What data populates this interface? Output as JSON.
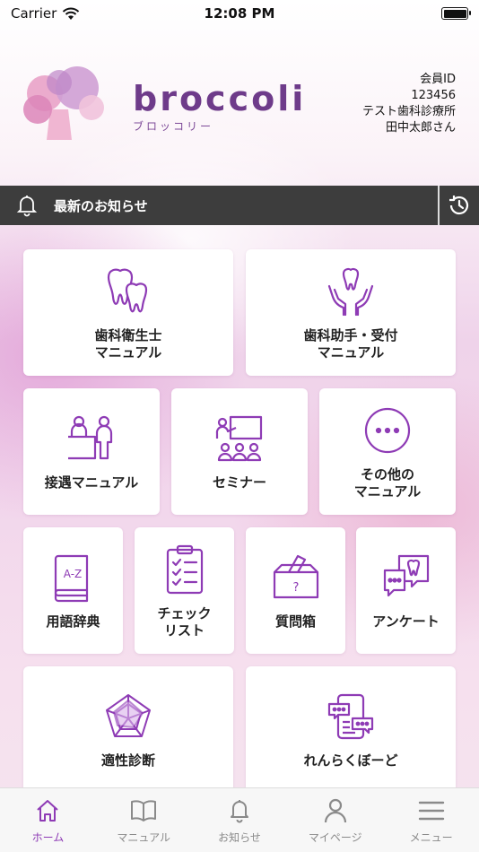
{
  "status_bar": {
    "carrier": "Carrier",
    "time": "12:08 PM"
  },
  "header": {
    "logo_text": "broccoli",
    "logo_subtitle": "ブロッコリー",
    "member_id_label": "会員ID",
    "member_id": "123456",
    "clinic": "テスト歯科診療所",
    "user_name": "田中太郎さん"
  },
  "news": {
    "label": "最新のお知らせ"
  },
  "tiles": [
    {
      "label": "歯科衛生士\nマニュアル",
      "icon": "teeth-icon"
    },
    {
      "label": "歯科助手・受付\nマニュアル",
      "icon": "tooth-hands-icon"
    },
    {
      "label": "接遇マニュアル",
      "icon": "reception-icon"
    },
    {
      "label": "セミナー",
      "icon": "seminar-icon"
    },
    {
      "label": "その他の\nマニュアル",
      "icon": "more-icon"
    },
    {
      "label": "用語辞典",
      "icon": "dictionary-icon"
    },
    {
      "label": "チェック\nリスト",
      "icon": "checklist-icon"
    },
    {
      "label": "質問箱",
      "icon": "question-box-icon"
    },
    {
      "label": "アンケート",
      "icon": "survey-icon"
    },
    {
      "label": "適性診断",
      "icon": "radar-chart-icon"
    },
    {
      "label": "れんらくぼーど",
      "icon": "message-board-icon"
    }
  ],
  "tabbar": [
    {
      "label": "ホーム",
      "icon": "home-icon",
      "active": true
    },
    {
      "label": "マニュアル",
      "icon": "book-icon",
      "active": false
    },
    {
      "label": "お知らせ",
      "icon": "bell-icon",
      "active": false
    },
    {
      "label": "マイページ",
      "icon": "person-icon",
      "active": false
    },
    {
      "label": "メニュー",
      "icon": "hamburger-icon",
      "active": false
    }
  ],
  "colors": {
    "accent": "#8e3bb5",
    "news_bar": "#3d3d3d",
    "brand": "#6e3b8a"
  }
}
